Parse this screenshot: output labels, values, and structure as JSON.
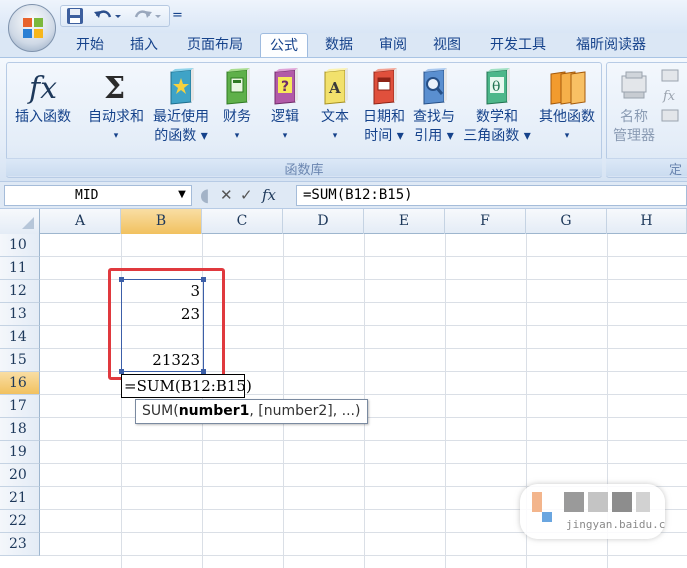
{
  "quick_access": {
    "save_icon": "save-icon",
    "undo_icon": "undo-icon",
    "redo_icon": "redo-icon",
    "customize_glyph": "="
  },
  "tabs": [
    "开始",
    "插入",
    "页面布局",
    "公式",
    "数据",
    "审阅",
    "视图",
    "开发工具",
    "福昕阅读器"
  ],
  "active_tab": "公式",
  "ribbon": {
    "group_label": "函数库",
    "group2_label": "定",
    "buttons": [
      {
        "line1": "插入函数",
        "line2": "",
        "icon": "fx-icon"
      },
      {
        "line1": "自动求和",
        "line2": "▾",
        "icon": "sigma-icon"
      },
      {
        "line1": "最近使用",
        "line2": "的函数 ▾",
        "icon": "recent-book-icon"
      },
      {
        "line1": "财务",
        "line2": "▾",
        "icon": "finance-book-icon"
      },
      {
        "line1": "逻辑",
        "line2": "▾",
        "icon": "logic-book-icon"
      },
      {
        "line1": "文本",
        "line2": "▾",
        "icon": "text-book-icon"
      },
      {
        "line1": "日期和",
        "line2": "时间 ▾",
        "icon": "date-book-icon"
      },
      {
        "line1": "查找与",
        "line2": "引用 ▾",
        "icon": "lookup-book-icon"
      },
      {
        "line1": "数学和",
        "line2": "三角函数 ▾",
        "icon": "math-book-icon"
      },
      {
        "line1": "其他函数",
        "line2": "▾",
        "icon": "more-books-icon"
      },
      {
        "line1": "名称",
        "line2": "管理器",
        "icon": "name-manager-icon"
      }
    ]
  },
  "formula_bar": {
    "name_box": "MID",
    "dropdown_glyph": "▼",
    "cancel_glyph": "✕",
    "enter_glyph": "✓",
    "fx_label": "fx",
    "formula": "=SUM(B12:B15)"
  },
  "columns": [
    "A",
    "B",
    "C",
    "D",
    "E",
    "F",
    "G",
    "H"
  ],
  "selected_column": "B",
  "rows": [
    "10",
    "11",
    "12",
    "13",
    "14",
    "15",
    "16",
    "17",
    "18",
    "19",
    "20",
    "21",
    "22",
    "23"
  ],
  "selected_row": "16",
  "cells": {
    "B12": "3",
    "B13": "23",
    "B15": "21323"
  },
  "edit_cell": "=SUM(B12:B15)",
  "tooltip": {
    "fn": "SUM(",
    "arg1": "number1",
    "rest": ", [number2], ...)"
  },
  "watermark_text": "jingyan.baidu.c"
}
